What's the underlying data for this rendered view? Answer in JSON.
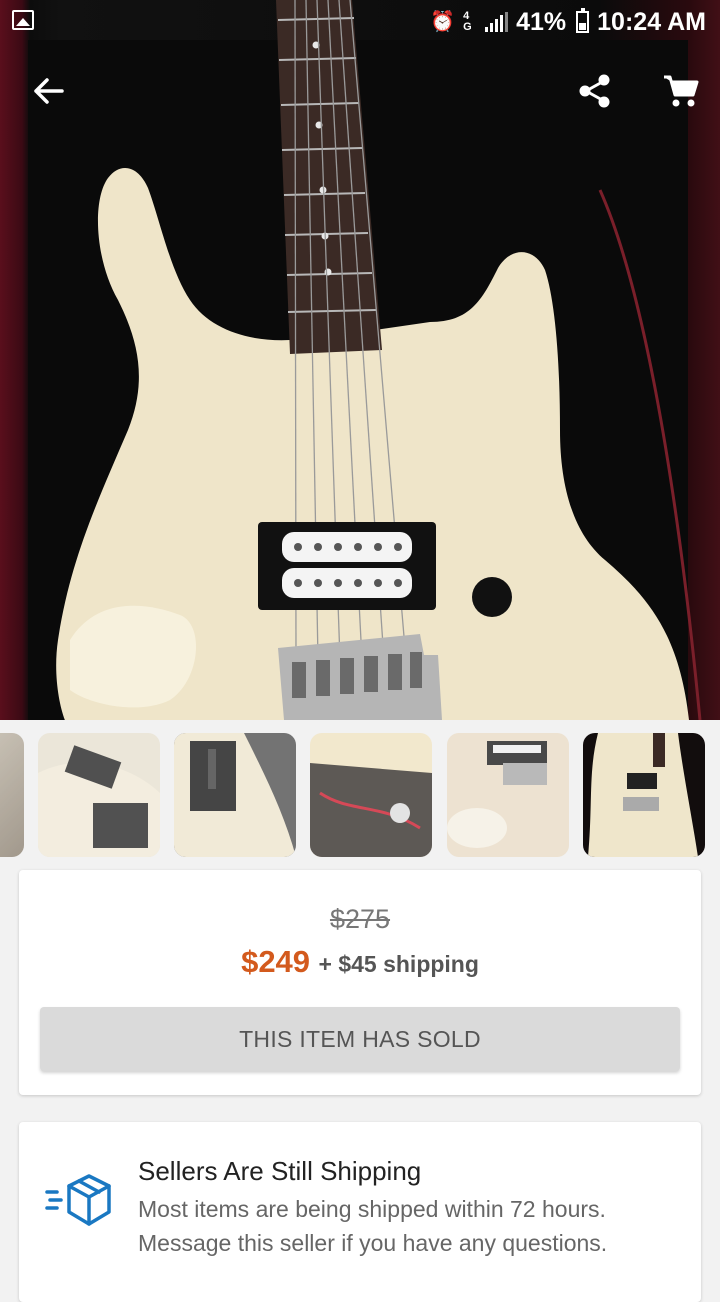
{
  "status_bar": {
    "battery": "41%",
    "time": "10:24 AM",
    "network": "4G"
  },
  "header": {
    "back_icon": "arrow-left-icon",
    "share_icon": "share-icon",
    "cart_icon": "cart-icon"
  },
  "thumbnails": [
    {
      "name": "thumb-partial"
    },
    {
      "name": "thumb-body-closeup"
    },
    {
      "name": "thumb-back-plate"
    },
    {
      "name": "thumb-cavity-wiring"
    },
    {
      "name": "thumb-pickup-bridge"
    },
    {
      "name": "thumb-full-guitar"
    }
  ],
  "pricing": {
    "original_price": "$275",
    "price": "$249",
    "shipping": "+ $45 shipping",
    "sold_label": "THIS ITEM HAS SOLD"
  },
  "notice": {
    "title": "Sellers Are Still Shipping",
    "line1": "Most items are being shipped within 72 hours.",
    "line2": "Message this seller if you have any questions."
  },
  "colors": {
    "price": "#d35a1d",
    "accent_blue": "#1a78c2"
  }
}
